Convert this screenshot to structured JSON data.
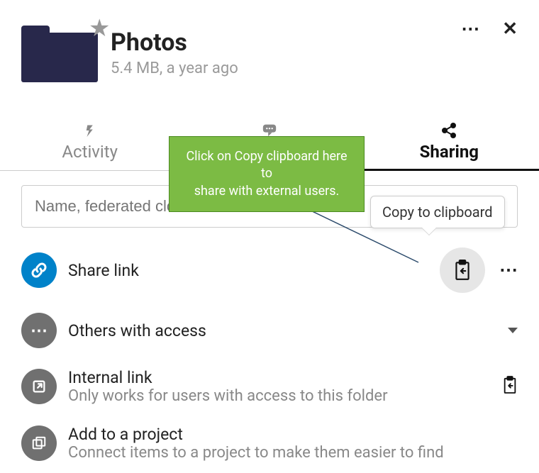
{
  "header": {
    "title": "Photos",
    "subtitle": "5.4 MB, a year ago"
  },
  "tabs": {
    "activity": "Activity",
    "comments": "",
    "sharing": "Sharing"
  },
  "share": {
    "placeholder": "Name, federated cloud ID or email address …",
    "tooltip": "Copy to clipboard",
    "shareLink": "Share link",
    "othersAccess": "Others with access",
    "internalLink": {
      "title": "Internal link",
      "sub": "Only works for users with access to this folder"
    },
    "addProject": {
      "title": "Add to a project",
      "sub": "Connect items to a project to make them easier to find"
    }
  },
  "annotation": {
    "line1": "Click on Copy clipboard here to",
    "line2": "share with external users."
  }
}
